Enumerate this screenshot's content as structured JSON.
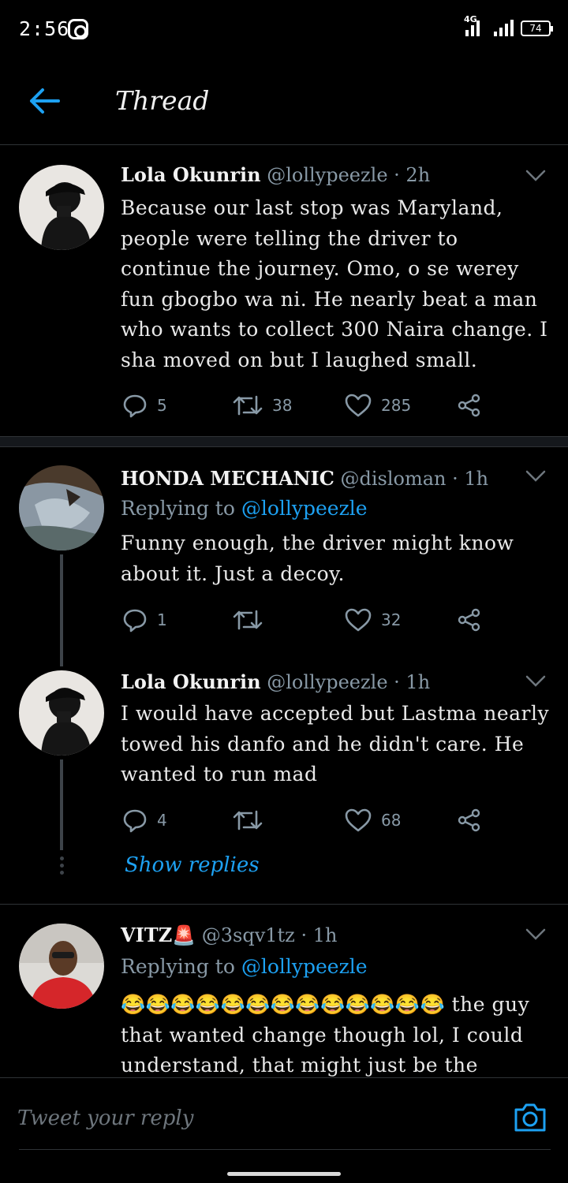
{
  "status_bar": {
    "time": "2:56",
    "network": "4G",
    "battery": "74"
  },
  "header": {
    "title": "Thread"
  },
  "tweets": [
    {
      "name": "Lola Okunrin",
      "handle": "@lollypeezle",
      "time": "· 2h",
      "replying_to": "",
      "text": "Because our last stop was Maryland, people were telling the driver to continue the journey. Omo, o se werey fun gbogbo wa ni. He nearly beat a man who wants to collect 300 Naira change. I sha moved on but I laughed small.",
      "replies": "5",
      "retweets": "38",
      "likes": "285"
    },
    {
      "name": "HONDA MECHANIC",
      "handle": "@disloman",
      "time": "· 1h",
      "replying_label": "Replying to",
      "replying_to": "@lollypeezle",
      "text": "Funny enough, the driver might know about it. Just a decoy.",
      "replies": "1",
      "retweets": "",
      "likes": "32"
    },
    {
      "name": "Lola Okunrin",
      "handle": "@lollypeezle",
      "time": "· 1h",
      "replying_to": "",
      "text": "I would have accepted but Lastma nearly towed his danfo and he didn't care. He wanted to run mad",
      "replies": "4",
      "retweets": "",
      "likes": "68"
    },
    {
      "name": "VITZ🚨",
      "handle": "@3sqv1tz",
      "time": "· 1h",
      "replying_label": "Replying to",
      "replying_to": "@lollypeezle",
      "text": "😂😂😂😂😂😂😂😂😂😂😂😂😂 the guy that wanted change though lol, I could understand, that might just be the"
    }
  ],
  "show_replies": "Show replies",
  "reply_bar": {
    "placeholder": "Tweet your reply"
  },
  "colors": {
    "accent": "#1da1f2",
    "muted": "#8899a6",
    "background": "#000000"
  },
  "icons": [
    "instagram-icon",
    "signal-icon",
    "battery-icon",
    "back-arrow-icon",
    "chevron-down-icon",
    "reply-icon",
    "retweet-icon",
    "like-icon",
    "share-icon",
    "camera-icon"
  ]
}
